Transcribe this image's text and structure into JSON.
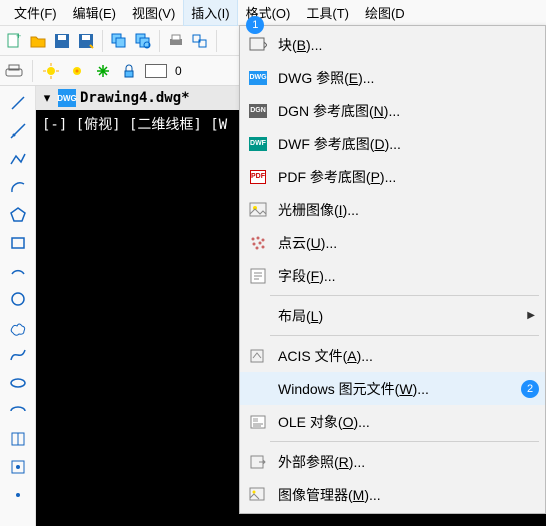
{
  "menubar": {
    "file": "文件(F)",
    "edit": "编辑(E)",
    "view": "视图(V)",
    "insert": "插入(I)",
    "format": "格式(O)",
    "tools": "工具(T)",
    "draw": "绘图(D"
  },
  "toolbar2": {
    "value": "0"
  },
  "doc": {
    "tab_title": "Drawing4.dwg*",
    "viewport": "[-] [俯视] [二维线框] [W"
  },
  "dropdown": {
    "block": "块(B)...",
    "dwg_ref": "DWG 参照(E)...",
    "dgn_ref": "DGN 参考底图(N)...",
    "dwf_ref": "DWF 参考底图(D)...",
    "pdf_ref": "PDF 参考底图(P)...",
    "raster": "光栅图像(I)...",
    "pointcloud": "点云(U)...",
    "field": "字段(F)...",
    "layout": "布局(L)",
    "acis": "ACIS 文件(A)...",
    "wmf": "Windows 图元文件(W)...",
    "ole": "OLE 对象(O)...",
    "xref": "外部参照(R)...",
    "imgmgr": "图像管理器(M)..."
  },
  "badges": {
    "menu": "1",
    "wmf": "2"
  }
}
